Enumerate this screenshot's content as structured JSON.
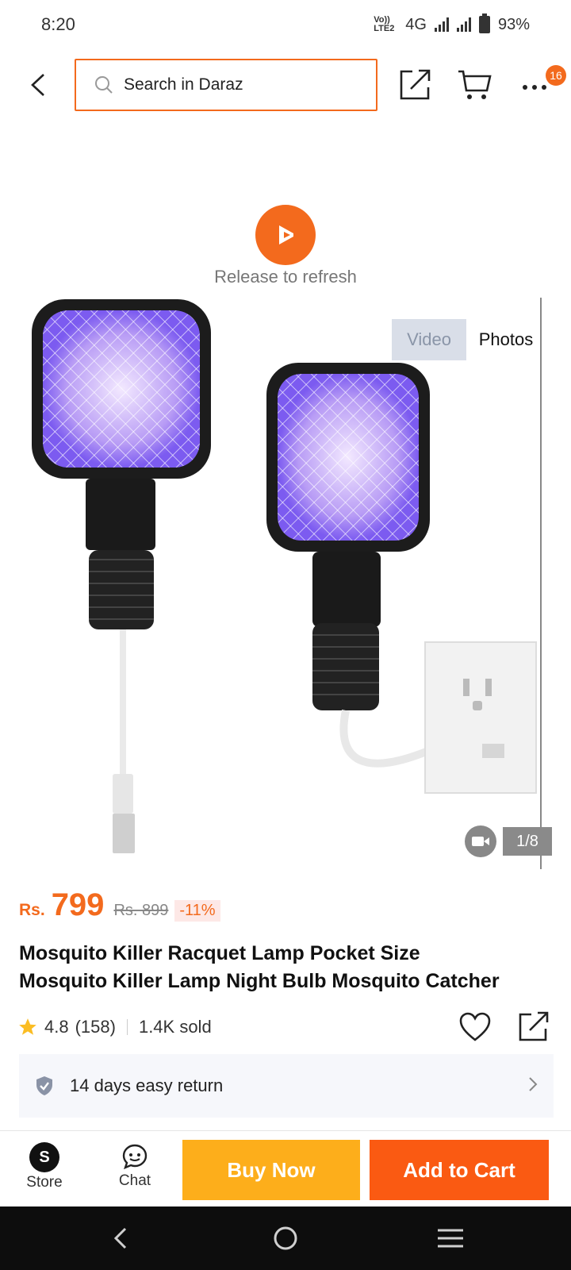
{
  "status_bar": {
    "time": "8:20",
    "volte": "Vo)) LTE2",
    "network": "4G",
    "battery": "93%"
  },
  "search": {
    "placeholder": "Search in Daraz"
  },
  "header": {
    "cart_badge": "16"
  },
  "refresh": {
    "text": "Release to refresh"
  },
  "gallery": {
    "tabs": [
      "Video",
      "Photos"
    ],
    "active_tab": "Photos",
    "counter": "1/8"
  },
  "product": {
    "currency": "Rs.",
    "price": "799",
    "old_price": "Rs. 899",
    "discount": "-11%",
    "title_line1": "Mosquito Killer Racquet Lamp Pocket Size",
    "title_line2": "Mosquito Killer Lamp Night Bulb Mosquito Catcher",
    "rating": "4.8",
    "reviews": "(158)",
    "sold": "1.4K sold"
  },
  "service": {
    "return_text": "14 days easy return"
  },
  "bottom": {
    "store_label": "Store",
    "chat_label": "Chat",
    "buy_now": "Buy Now",
    "add_to_cart": "Add to Cart"
  },
  "colors": {
    "accent": "#f36a1d",
    "buy_now": "#fdae1b",
    "add_to_cart": "#fa5a12",
    "star": "#fbbd23"
  }
}
